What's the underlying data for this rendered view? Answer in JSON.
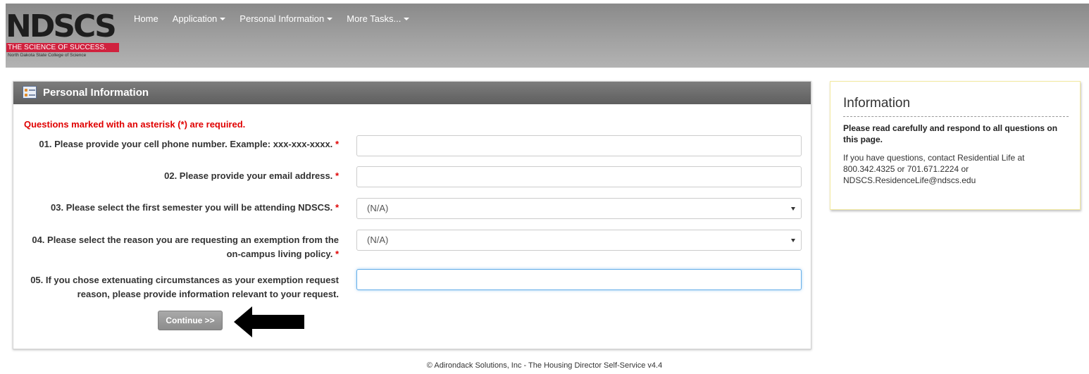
{
  "header": {
    "logo": {
      "mark": "NDSCS",
      "tagline": "THE SCIENCE OF SUCCESS.",
      "subtitle": "North Dakota State College of Science"
    },
    "nav": [
      {
        "label": "Home",
        "has_dropdown": false
      },
      {
        "label": "Application",
        "has_dropdown": true
      },
      {
        "label": "Personal Information",
        "has_dropdown": true
      },
      {
        "label": "More Tasks...",
        "has_dropdown": true
      }
    ]
  },
  "panel": {
    "title": "Personal Information",
    "required_note": "Questions marked with an asterisk (*) are required.",
    "questions": [
      {
        "label": "01. Please provide your cell phone number. Example: xxx-xxx-xxxx.",
        "required": "*",
        "type": "text",
        "value": ""
      },
      {
        "label": "02. Please provide your email address.",
        "required": "*",
        "type": "text",
        "value": ""
      },
      {
        "label": "03. Please select the first semester you will be attending NDSCS.",
        "required": "*",
        "type": "select",
        "value": "(N/A)"
      },
      {
        "label_line1": "04. Please select the reason you are requesting an exemption from the",
        "label_line2": "on-campus living policy.",
        "required": "*",
        "type": "select",
        "value": "(N/A)"
      },
      {
        "label_line1": "05. If you chose extenuating circumstances as your exemption request",
        "label_line2": "reason, please provide information relevant to your request.",
        "type": "text",
        "value": ""
      }
    ],
    "continue_label": "Continue >>"
  },
  "info": {
    "title": "Information",
    "strong": "Please read carefully and respond to all questions on this page.",
    "line1": "If you have questions, contact Residential Life at",
    "line2": "800.342.4325 or 701.671.2224 or",
    "line3": "NDSCS.ResidenceLife@ndscs.edu"
  },
  "footer": "© Adirondack Solutions, Inc - The Housing Director Self-Service v4.4",
  "colors": {
    "header_bg": "#a3a3a3",
    "panel_header": "#6e6e6e",
    "required": "#e00000",
    "brand_red": "#d0223e",
    "focus": "#66afe9"
  }
}
